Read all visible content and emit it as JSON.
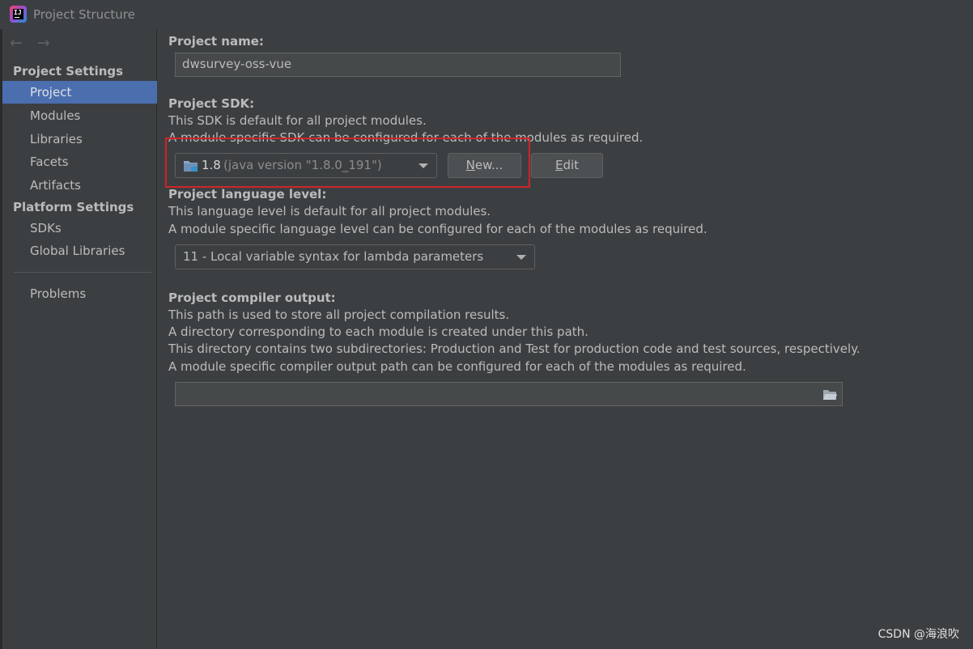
{
  "window": {
    "title": "Project Structure"
  },
  "sidebar": {
    "back_arrow": "←",
    "forward_arrow": "→",
    "project_settings_header": "Project Settings",
    "project_settings_items": [
      "Project",
      "Modules",
      "Libraries",
      "Facets",
      "Artifacts"
    ],
    "platform_settings_header": "Platform Settings",
    "platform_settings_items": [
      "SDKs",
      "Global Libraries"
    ],
    "problems_label": "Problems",
    "selected_item": "Project"
  },
  "project_name": {
    "label": "Project name:",
    "value": "dwsurvey-oss-vue"
  },
  "project_sdk": {
    "label": "Project SDK:",
    "desc1": "This SDK is default for all project modules.",
    "desc2": "A module specific SDK can be configured for each of the modules as required.",
    "selected_version": "1.8",
    "selected_detail": "(java version \"1.8.0_191\")",
    "new_button_mnemonic": "N",
    "new_button_rest": "ew...",
    "edit_button_mnemonic": "E",
    "edit_button_rest": "dit"
  },
  "language_level": {
    "label": "Project language level:",
    "desc1": "This language level is default for all project modules.",
    "desc2": "A module specific language level can be configured for each of the modules as required.",
    "selected": "11 - Local variable syntax for lambda parameters"
  },
  "compiler_output": {
    "label": "Project compiler output:",
    "desc1": "This path is used to store all project compilation results.",
    "desc2": "A directory corresponding to each module is created under this path.",
    "desc3": "This directory contains two subdirectories: Production and Test for production code and test sources, respectively.",
    "desc4": "A module specific compiler output path can be configured for each of the modules as required.",
    "path_value": ""
  },
  "watermark": "CSDN @海浪吹",
  "colors": {
    "background": "#3c3f41",
    "selection": "#4b6eaf",
    "highlight_box": "#d22428"
  }
}
